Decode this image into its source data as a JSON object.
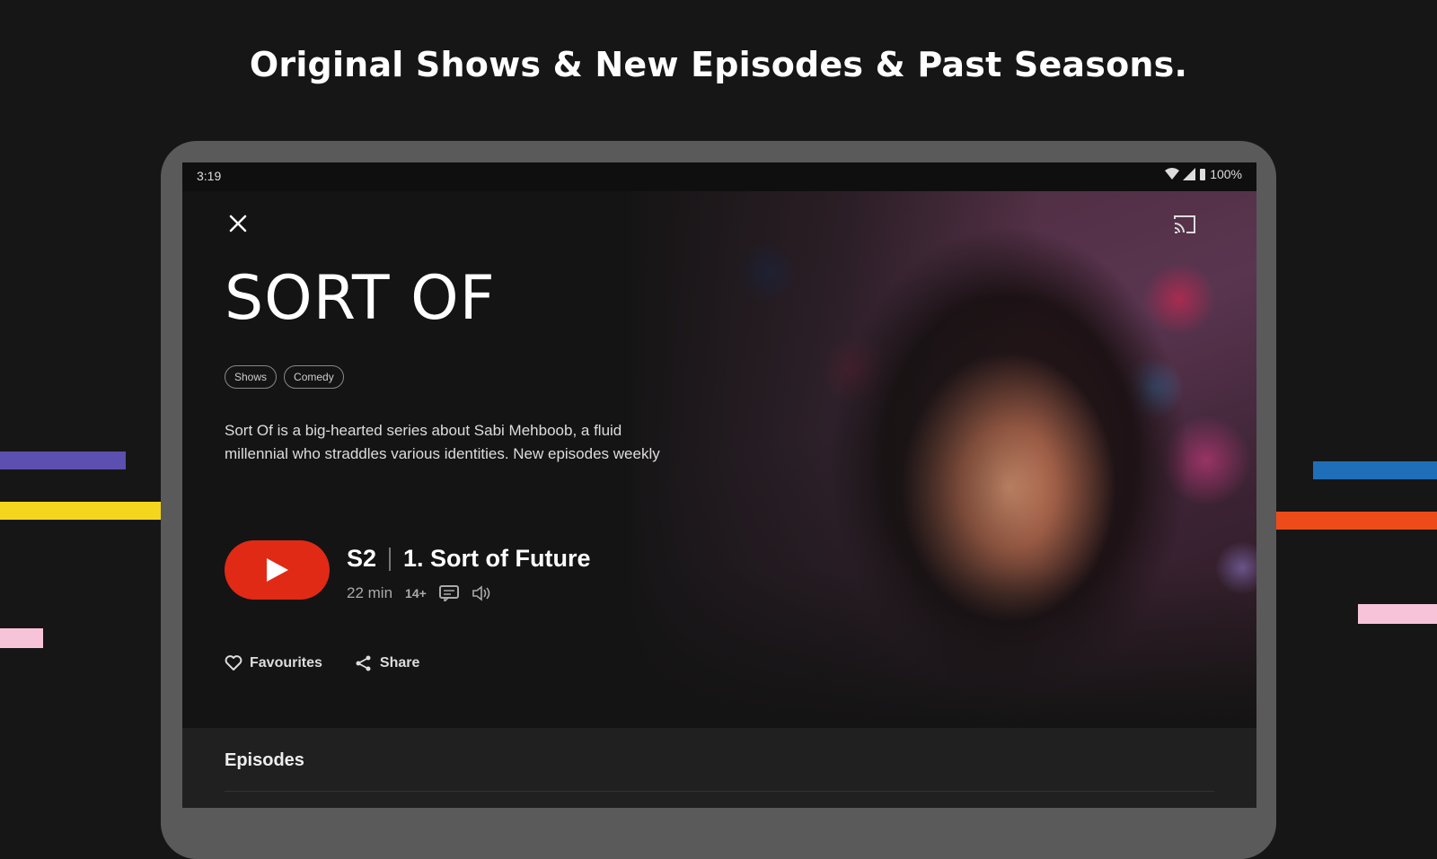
{
  "banner": {
    "headline": "Original Shows & New Episodes & Past Seasons."
  },
  "colors": {
    "background": "#161616",
    "stripe_purple": "#5b4fb0",
    "stripe_yellow": "#f5d61e",
    "stripe_pink": "#f6c3d8",
    "stripe_blue": "#1f6fb8",
    "stripe_orange": "#ee4b1a",
    "play_red": "#e02a16",
    "device_frame": "#5a5a5a"
  },
  "status_bar": {
    "time": "3:19",
    "battery": "100%"
  },
  "show": {
    "title": "SORT OF",
    "tags": [
      "Shows",
      "Comedy"
    ],
    "description": "Sort Of is a big-hearted series about Sabi Mehboob, a fluid millennial who straddles various identities. New episodes weekly"
  },
  "episode": {
    "season": "S2",
    "title": "1. Sort of Future",
    "duration": "22 min",
    "rating": "14+"
  },
  "actions": {
    "favourites_label": "Favourites",
    "share_label": "Share"
  },
  "episodes_section": {
    "label": "Episodes"
  },
  "icons": [
    "close-icon",
    "cast-icon",
    "wifi-icon",
    "signal-icon",
    "battery-icon",
    "play-icon",
    "captions-icon",
    "audio-description-icon",
    "heart-icon",
    "share-icon"
  ]
}
